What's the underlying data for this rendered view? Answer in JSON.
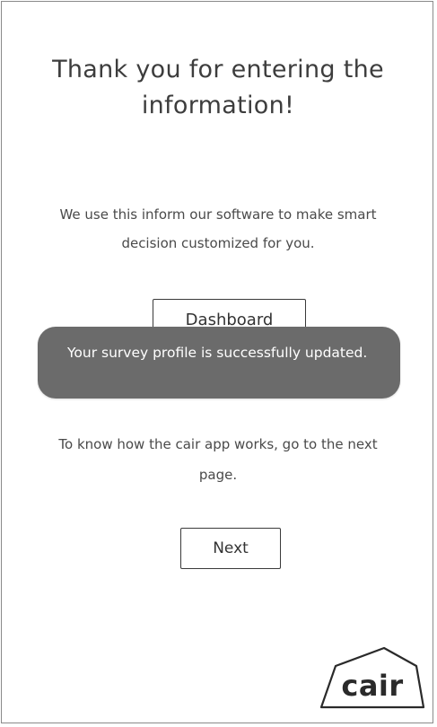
{
  "page": {
    "title": "Thank you for entering the information!",
    "info_text": "We use this inform our software to make smart decision customized for you.",
    "help_text": "To know how the cair app works, go to the next page."
  },
  "buttons": {
    "dashboard_label": "Dashboard",
    "next_label": "Next"
  },
  "toast": {
    "message": "Your survey profile is successfully updated."
  },
  "brand": {
    "logo_text": "cair",
    "logo_icon": "house-outline-icon"
  },
  "colors": {
    "toast_background": "#6b6b6b",
    "toast_text": "#ffffff",
    "text": "#3d3d3d",
    "button_border": "#3a3a3a"
  }
}
